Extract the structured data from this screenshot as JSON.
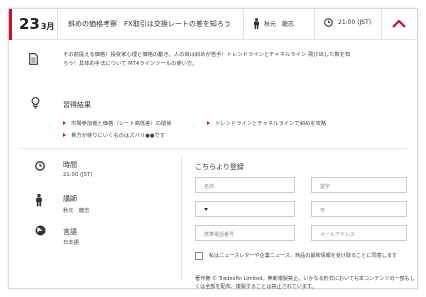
{
  "header": {
    "day": "23",
    "month": "3月",
    "title": "斜めの価格考察　FX取引は交換レートの差を知ろう",
    "speaker": "秋元　龍志",
    "time": "21:00 (JST)"
  },
  "description": {
    "lines": [
      "その前提える価格！投資家心理と価格の動き。人の目は斜めが苦手！トレンドラインとチャネルライン 飛び出した数を知",
      "ろう！具体的手法について MT4ラインツールの使い方。"
    ]
  },
  "results": {
    "title": "習得結果",
    "items": [
      "市場参加者と価格（レート高低差）の関係",
      "トレンドラインとチャネルラインで斜めを攻略",
      "貴方が使りにいくものはズバリ●●です"
    ]
  },
  "info": {
    "time": {
      "label": "時間",
      "value": "21:00 (JST)"
    },
    "speaker": {
      "label": "講師",
      "value": "秋元　龍志"
    },
    "language": {
      "label": "言語",
      "value": "日本語"
    }
  },
  "form": {
    "title": "こちらより登録",
    "first_name_placeholder": "名前",
    "last_name_placeholder": "苗字",
    "country_value": "",
    "city_placeholder": "市",
    "phone_placeholder": "携帯電話番号",
    "email_placeholder": "メールアドレス",
    "consent": "私はニュースレターや企業ニュース、商品の最新情報を受け取ることに同意します",
    "copyright": "著作権 © Tradexfin Limited。無断複製禁止。いかなる形式においても本コンテンツの一部もしくは全部を配布、複製することは禁止されています。"
  },
  "colors": {
    "accent": "#c8102e"
  },
  "icons": {
    "speaker": "person-icon",
    "time": "clock-icon",
    "collapse": "chevron-up-icon",
    "description": "document-icon",
    "results": "lightbulb-icon",
    "language": "globe-icon"
  }
}
